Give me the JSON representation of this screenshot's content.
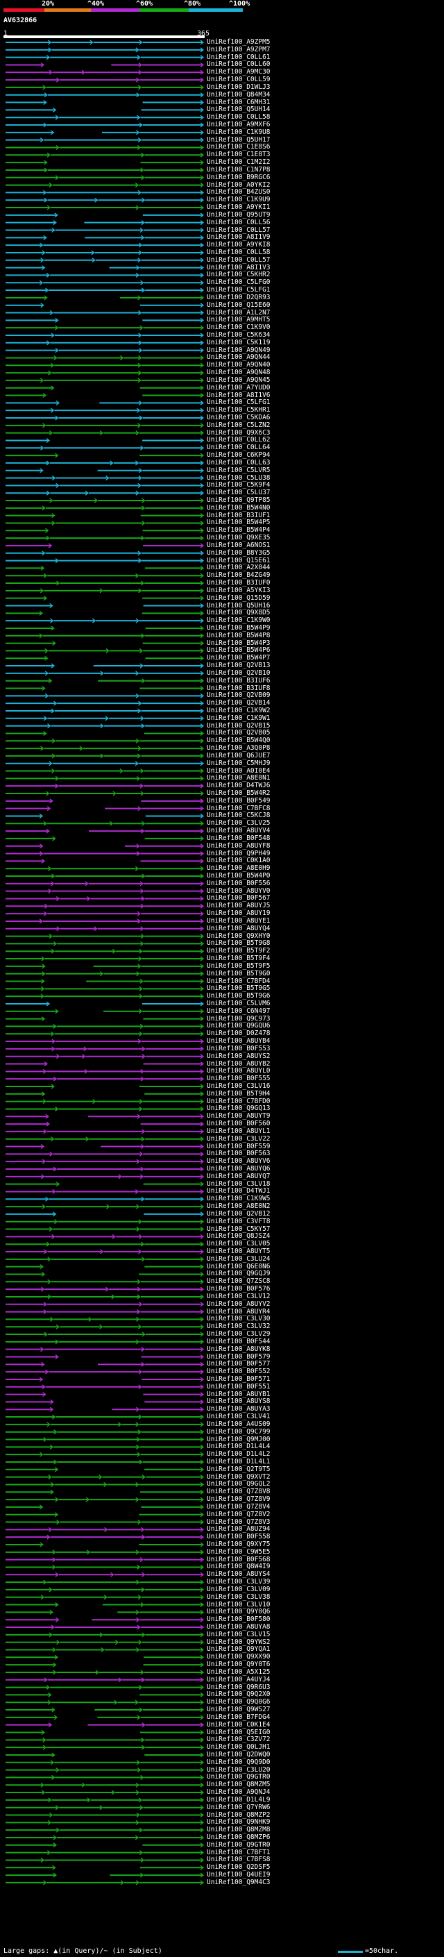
{
  "header": {
    "scale_labels": [
      "20%",
      "^40%",
      "^60%",
      "^80%",
      "^100%"
    ],
    "scale_colors": [
      "#e8102a",
      "#e07b1a",
      "#b02cd0",
      "#18a818",
      "#1cb3d8"
    ],
    "query_id": "AV632866",
    "query_start": "1",
    "query_end": "365"
  },
  "rows": [
    {
      "id": "UniRef100_A9ZPM5",
      "color": "cyan"
    },
    {
      "id": "UniRef100_A9ZPM7",
      "color": "cyan"
    },
    {
      "id": "UniRef100_C0LL61",
      "color": "cyan"
    },
    {
      "id": "UniRef100_C0LL60",
      "color": "magenta"
    },
    {
      "id": "UniRef100_A9MC30",
      "color": "magenta"
    },
    {
      "id": "UniRef100_C0LL59",
      "color": "magenta"
    },
    {
      "id": "UniRef100_D1WLJ3",
      "color": "green"
    },
    {
      "id": "UniRef100_Q84M34",
      "color": "cyan"
    },
    {
      "id": "UniRef100_C6MH31",
      "color": "cyan"
    },
    {
      "id": "UniRef100_Q5UH14",
      "color": "cyan"
    },
    {
      "id": "UniRef100_C0LL58",
      "color": "cyan"
    },
    {
      "id": "UniRef100_A9MXF6",
      "color": "cyan"
    },
    {
      "id": "UniRef100_C1K9U8",
      "color": "cyan"
    },
    {
      "id": "UniRef100_Q5UH17",
      "color": "cyan"
    },
    {
      "id": "UniRef100_C1E8S6",
      "color": "green"
    },
    {
      "id": "UniRef100_C1E8T3",
      "color": "green"
    },
    {
      "id": "UniRef100_C1M2I2",
      "color": "green"
    },
    {
      "id": "UniRef100_C1N7P8",
      "color": "green"
    },
    {
      "id": "UniRef100_B9RGC6",
      "color": "green"
    },
    {
      "id": "UniRef100_A0YKI2",
      "color": "green"
    },
    {
      "id": "UniRef100_B4ZUS0",
      "color": "cyan"
    },
    {
      "id": "UniRef100_C1K9U9",
      "color": "cyan"
    },
    {
      "id": "UniRef100_A9YKI1",
      "color": "green"
    },
    {
      "id": "UniRef100_Q95UT9",
      "color": "cyan"
    },
    {
      "id": "UniRef100_C0LL56",
      "color": "cyan"
    },
    {
      "id": "UniRef100_C0LL57",
      "color": "cyan"
    },
    {
      "id": "UniRef100_A8I1V9",
      "color": "cyan"
    },
    {
      "id": "UniRef100_A9YKI8",
      "color": "cyan"
    },
    {
      "id": "UniRef100_C0LL58",
      "color": "cyan"
    },
    {
      "id": "UniRef100_C0LL57",
      "color": "cyan"
    },
    {
      "id": "UniRef100_A8I1V3",
      "color": "cyan"
    },
    {
      "id": "UniRef100_C5KHR2",
      "color": "cyan"
    },
    {
      "id": "UniRef100_C5LFG0",
      "color": "cyan"
    },
    {
      "id": "UniRef100_C5LFG1",
      "color": "cyan"
    },
    {
      "id": "UniRef100_D2QR93",
      "color": "green"
    },
    {
      "id": "UniRef100_Q15E60",
      "color": "cyan"
    },
    {
      "id": "UniRef100_A1L2N7",
      "color": "cyan"
    },
    {
      "id": "UniRef100_A9MHT5",
      "color": "cyan"
    },
    {
      "id": "UniRef100_C1K9V0",
      "color": "green"
    },
    {
      "id": "UniRef100_C5K634",
      "color": "cyan"
    },
    {
      "id": "UniRef100_C5K119",
      "color": "cyan"
    },
    {
      "id": "UniRef100_A9QN49",
      "color": "cyan"
    },
    {
      "id": "UniRef100_A9QN44",
      "color": "green"
    },
    {
      "id": "UniRef100_A9QN40",
      "color": "green"
    },
    {
      "id": "UniRef100_A9QN48",
      "color": "green"
    },
    {
      "id": "UniRef100_A9QN45",
      "color": "green"
    },
    {
      "id": "UniRef100_A7YUD0",
      "color": "green"
    },
    {
      "id": "UniRef100_A8I1V6",
      "color": "green"
    },
    {
      "id": "UniRef100_C5LFG1",
      "color": "cyan"
    },
    {
      "id": "UniRef100_C5KHR1",
      "color": "cyan"
    },
    {
      "id": "UniRef100_C5KDA6",
      "color": "cyan"
    },
    {
      "id": "UniRef100_C5LZN2",
      "color": "green"
    },
    {
      "id": "UniRef100_Q9X6C3",
      "color": "green"
    },
    {
      "id": "UniRef100_C0LL62",
      "color": "cyan"
    },
    {
      "id": "UniRef100_C0LL64",
      "color": "cyan"
    },
    {
      "id": "UniRef100_C6KP94",
      "color": "green"
    },
    {
      "id": "UniRef100_C0LL63",
      "color": "cyan"
    },
    {
      "id": "UniRef100_C5LVR5",
      "color": "cyan"
    },
    {
      "id": "UniRef100_C5LU38",
      "color": "cyan"
    },
    {
      "id": "UniRef100_C5K9F4",
      "color": "cyan"
    },
    {
      "id": "UniRef100_C5LU37",
      "color": "cyan"
    },
    {
      "id": "UniRef100_Q9TP85",
      "color": "green"
    },
    {
      "id": "UniRef100_B5W4N0",
      "color": "green"
    },
    {
      "id": "UniRef100_B3IUF1",
      "color": "green"
    },
    {
      "id": "UniRef100_B5W4P5",
      "color": "green"
    },
    {
      "id": "UniRef100_B5W4P4",
      "color": "green"
    },
    {
      "id": "UniRef100_Q9XE35",
      "color": "green"
    },
    {
      "id": "UniRef100_A6NOS1",
      "color": "magenta"
    },
    {
      "id": "UniRef100_B8Y3G5",
      "color": "cyan"
    },
    {
      "id": "UniRef100_Q15E61",
      "color": "cyan"
    },
    {
      "id": "UniRef100_A2X044",
      "color": "green"
    },
    {
      "id": "UniRef100_B4ZG49",
      "color": "green"
    },
    {
      "id": "UniRef100_B3IUF0",
      "color": "green"
    },
    {
      "id": "UniRef100_A5YKI3",
      "color": "green"
    },
    {
      "id": "UniRef100_Q15D59",
      "color": "green"
    },
    {
      "id": "UniRef100_Q5UH16",
      "color": "cyan"
    },
    {
      "id": "UniRef100_Q9X8D5",
      "color": "green"
    },
    {
      "id": "UniRef100_C1K9W0",
      "color": "cyan"
    },
    {
      "id": "UniRef100_B5W4P9",
      "color": "green"
    },
    {
      "id": "UniRef100_B5W4P8",
      "color": "green"
    },
    {
      "id": "UniRef100_B5W4P3",
      "color": "green"
    },
    {
      "id": "UniRef100_B5W4P6",
      "color": "green"
    },
    {
      "id": "UniRef100_B5W4P7",
      "color": "green"
    },
    {
      "id": "UniRef100_Q2VB13",
      "color": "cyan"
    },
    {
      "id": "UniRef100_Q2VB10",
      "color": "cyan"
    },
    {
      "id": "UniRef100_B3IUF6",
      "color": "green"
    },
    {
      "id": "UniRef100_B3IUF8",
      "color": "green"
    },
    {
      "id": "UniRef100_Q2VB09",
      "color": "cyan"
    },
    {
      "id": "UniRef100_Q2VB14",
      "color": "cyan"
    },
    {
      "id": "UniRef100_C1K9W2",
      "color": "cyan"
    },
    {
      "id": "UniRef100_C1K9W1",
      "color": "cyan"
    },
    {
      "id": "UniRef100_Q2VB15",
      "color": "cyan"
    },
    {
      "id": "UniRef100_Q2VB05",
      "color": "green"
    },
    {
      "id": "UniRef100_B5W4Q0",
      "color": "green"
    },
    {
      "id": "UniRef100_A3Q0P8",
      "color": "green"
    },
    {
      "id": "UniRef100_Q6JUE7",
      "color": "green"
    },
    {
      "id": "UniRef100_C5MHJ9",
      "color": "cyan"
    },
    {
      "id": "UniRef100_A0I0E4",
      "color": "green"
    },
    {
      "id": "UniRef100_A8E0N1",
      "color": "green"
    },
    {
      "id": "UniRef100_D4TWJ6",
      "color": "magenta"
    },
    {
      "id": "UniRef100_B5W4R2",
      "color": "green"
    },
    {
      "id": "UniRef100_B0F549",
      "color": "magenta"
    },
    {
      "id": "UniRef100_C7BFC8",
      "color": "magenta"
    },
    {
      "id": "UniRef100_C5KCJ8",
      "color": "cyan"
    },
    {
      "id": "UniRef100_C3LV25",
      "color": "green"
    },
    {
      "id": "UniRef100_A8UYV4",
      "color": "magenta"
    },
    {
      "id": "UniRef100_B0F548",
      "color": "green"
    },
    {
      "id": "UniRef100_A8UYF8",
      "color": "magenta"
    },
    {
      "id": "UniRef100_Q9PH49",
      "color": "magenta"
    },
    {
      "id": "UniRef100_C0K1A0",
      "color": "magenta"
    },
    {
      "id": "UniRef100_A8E0H9",
      "color": "green"
    },
    {
      "id": "UniRef100_B5W4P0",
      "color": "green"
    },
    {
      "id": "UniRef100_B0F556",
      "color": "magenta"
    },
    {
      "id": "UniRef100_A8UYV0",
      "color": "magenta"
    },
    {
      "id": "UniRef100_B0F567",
      "color": "magenta"
    },
    {
      "id": "UniRef100_A8UYJ5",
      "color": "magenta"
    },
    {
      "id": "UniRef100_A8UY19",
      "color": "magenta"
    },
    {
      "id": "UniRef100_A8UYE1",
      "color": "magenta"
    },
    {
      "id": "UniRef100_A8UYQ4",
      "color": "magenta"
    },
    {
      "id": "UniRef100_Q9XHY0",
      "color": "green"
    },
    {
      "id": "UniRef100_B5T9G8",
      "color": "green"
    },
    {
      "id": "UniRef100_B5T9F2",
      "color": "green"
    },
    {
      "id": "UniRef100_B5T9F4",
      "color": "green"
    },
    {
      "id": "UniRef100_B5T9F5",
      "color": "green"
    },
    {
      "id": "UniRef100_B5T9G0",
      "color": "green"
    },
    {
      "id": "UniRef100_C7BFD4",
      "color": "green"
    },
    {
      "id": "UniRef100_B5T9G5",
      "color": "green"
    },
    {
      "id": "UniRef100_B5T9G6",
      "color": "green"
    },
    {
      "id": "UniRef100_C5LVM6",
      "color": "cyan"
    },
    {
      "id": "UniRef100_C6N497",
      "color": "green"
    },
    {
      "id": "UniRef100_Q9C973",
      "color": "green"
    },
    {
      "id": "UniRef100_Q9GQU6",
      "color": "green"
    },
    {
      "id": "UniRef100_D0Z478",
      "color": "green"
    },
    {
      "id": "UniRef100_A8UYB4",
      "color": "magenta"
    },
    {
      "id": "UniRef100_B0F553",
      "color": "magenta"
    },
    {
      "id": "UniRef100_A8UYS2",
      "color": "magenta"
    },
    {
      "id": "UniRef100_A8UYB2",
      "color": "magenta"
    },
    {
      "id": "UniRef100_A8UYL0",
      "color": "magenta"
    },
    {
      "id": "UniRef100_B0F555",
      "color": "magenta"
    },
    {
      "id": "UniRef100_C3LV16",
      "color": "green"
    },
    {
      "id": "UniRef100_B5T9H4",
      "color": "green"
    },
    {
      "id": "UniRef100_C7BFD0",
      "color": "green"
    },
    {
      "id": "UniRef100_Q9GQ13",
      "color": "green"
    },
    {
      "id": "UniRef100_A8UYT9",
      "color": "magenta"
    },
    {
      "id": "UniRef100_B0F560",
      "color": "magenta"
    },
    {
      "id": "UniRef100_A8UYL1",
      "color": "magenta"
    },
    {
      "id": "UniRef100_C3LV22",
      "color": "green"
    },
    {
      "id": "UniRef100_B0F559",
      "color": "magenta"
    },
    {
      "id": "UniRef100_B0F563",
      "color": "magenta"
    },
    {
      "id": "UniRef100_A8UYV6",
      "color": "magenta"
    },
    {
      "id": "UniRef100_A8UYQ6",
      "color": "magenta"
    },
    {
      "id": "UniRef100_A8UYQ7",
      "color": "magenta"
    },
    {
      "id": "UniRef100_C3LV18",
      "color": "green"
    },
    {
      "id": "UniRef100_D4TWJ1",
      "color": "magenta"
    },
    {
      "id": "UniRef100_C1K9W5",
      "color": "cyan"
    },
    {
      "id": "UniRef100_A8E0N2",
      "color": "green"
    },
    {
      "id": "UniRef100_Q2VB12",
      "color": "cyan"
    },
    {
      "id": "UniRef100_C3VFT8",
      "color": "green"
    },
    {
      "id": "UniRef100_C5KY57",
      "color": "green"
    },
    {
      "id": "UniRef100_Q8JSZ4",
      "color": "magenta"
    },
    {
      "id": "UniRef100_C3LV05",
      "color": "green"
    },
    {
      "id": "UniRef100_A8UYT5",
      "color": "magenta"
    },
    {
      "id": "UniRef100_C3LU24",
      "color": "green"
    },
    {
      "id": "UniRef100_Q6E0N6",
      "color": "green"
    },
    {
      "id": "UniRef100_Q9GQJ9",
      "color": "green"
    },
    {
      "id": "UniRef100_Q7ZSC8",
      "color": "green"
    },
    {
      "id": "UniRef100_B0F576",
      "color": "magenta"
    },
    {
      "id": "UniRef100_C3LV12",
      "color": "green"
    },
    {
      "id": "UniRef100_A8UYV2",
      "color": "magenta"
    },
    {
      "id": "UniRef100_A8UYR4",
      "color": "magenta"
    },
    {
      "id": "UniRef100_C3LV30",
      "color": "green"
    },
    {
      "id": "UniRef100_C3LV32",
      "color": "green"
    },
    {
      "id": "UniRef100_C3LV29",
      "color": "green"
    },
    {
      "id": "UniRef100_B0F544",
      "color": "green"
    },
    {
      "id": "UniRef100_A8UYK8",
      "color": "magenta"
    },
    {
      "id": "UniRef100_B0F579",
      "color": "magenta"
    },
    {
      "id": "UniRef100_B0F577",
      "color": "magenta"
    },
    {
      "id": "UniRef100_B0F552",
      "color": "magenta"
    },
    {
      "id": "UniRef100_B0F571",
      "color": "magenta"
    },
    {
      "id": "UniRef100_B0F551",
      "color": "magenta"
    },
    {
      "id": "UniRef100_A8UYB1",
      "color": "magenta"
    },
    {
      "id": "UniRef100_A8UYS8",
      "color": "magenta"
    },
    {
      "id": "UniRef100_A8UYA3",
      "color": "magenta"
    },
    {
      "id": "UniRef100_C3LV41",
      "color": "green"
    },
    {
      "id": "UniRef100_A4US09",
      "color": "green"
    },
    {
      "id": "UniRef100_Q9C799",
      "color": "green"
    },
    {
      "id": "UniRef100_Q9MJ00",
      "color": "green"
    },
    {
      "id": "UniRef100_D1L4L4",
      "color": "green"
    },
    {
      "id": "UniRef100_D1L4L2",
      "color": "green"
    },
    {
      "id": "UniRef100_D1L4L1",
      "color": "green"
    },
    {
      "id": "UniRef100_Q2T9T5",
      "color": "green"
    },
    {
      "id": "UniRef100_Q9XVT2",
      "color": "green"
    },
    {
      "id": "UniRef100_Q9GQL2",
      "color": "green"
    },
    {
      "id": "UniRef100_Q7Z8V8",
      "color": "green"
    },
    {
      "id": "UniRef100_Q7Z8V9",
      "color": "green"
    },
    {
      "id": "UniRef100_Q7Z8V4",
      "color": "green"
    },
    {
      "id": "UniRef100_Q7Z8V2",
      "color": "green"
    },
    {
      "id": "UniRef100_Q7Z8V3",
      "color": "green"
    },
    {
      "id": "UniRef100_A8UZ94",
      "color": "magenta"
    },
    {
      "id": "UniRef100_B0F558",
      "color": "magenta"
    },
    {
      "id": "UniRef100_Q9XY75",
      "color": "green"
    },
    {
      "id": "UniRef100_C9W5E5",
      "color": "green"
    },
    {
      "id": "UniRef100_B0F568",
      "color": "magenta"
    },
    {
      "id": "UniRef100_Q8W4I9",
      "color": "green"
    },
    {
      "id": "UniRef100_A8UYS4",
      "color": "magenta"
    },
    {
      "id": "UniRef100_C3LV39",
      "color": "green"
    },
    {
      "id": "UniRef100_C3LV09",
      "color": "green"
    },
    {
      "id": "UniRef100_C3LV38",
      "color": "green"
    },
    {
      "id": "UniRef100_C3LV10",
      "color": "green"
    },
    {
      "id": "UniRef100_Q9Y0Q6",
      "color": "green"
    },
    {
      "id": "UniRef100_B0F580",
      "color": "magenta"
    },
    {
      "id": "UniRef100_A8UYA8",
      "color": "magenta"
    },
    {
      "id": "UniRef100_C3LV15",
      "color": "green"
    },
    {
      "id": "UniRef100_Q9YWS2",
      "color": "green"
    },
    {
      "id": "UniRef100_Q9YQA1",
      "color": "green"
    },
    {
      "id": "UniRef100_Q9XX90",
      "color": "green"
    },
    {
      "id": "UniRef100_Q9Y0T6",
      "color": "green"
    },
    {
      "id": "UniRef100_A5X125",
      "color": "green"
    },
    {
      "id": "UniRef100_A4UYJ4",
      "color": "magenta"
    },
    {
      "id": "UniRef100_Q9R6U3",
      "color": "green"
    },
    {
      "id": "UniRef100_Q9Q2X0",
      "color": "green"
    },
    {
      "id": "UniRef100_Q9Q0G6",
      "color": "green"
    },
    {
      "id": "UniRef100_Q9WS27",
      "color": "green"
    },
    {
      "id": "UniRef100_B7FDG4",
      "color": "green"
    },
    {
      "id": "UniRef100_C0K1E4",
      "color": "magenta"
    },
    {
      "id": "UniRef100_Q5EIG0",
      "color": "green"
    },
    {
      "id": "UniRef100_C3ZV72",
      "color": "green"
    },
    {
      "id": "UniRef100_Q0LJH1",
      "color": "green"
    },
    {
      "id": "UniRef100_Q2DWQ0",
      "color": "green"
    },
    {
      "id": "UniRef100_Q9Q9D0",
      "color": "green"
    },
    {
      "id": "UniRef100_C3LU20",
      "color": "green"
    },
    {
      "id": "UniRef100_Q9GTR0",
      "color": "green"
    },
    {
      "id": "UniRef100_Q8MZM5",
      "color": "green"
    },
    {
      "id": "UniRef100_A9QNJ4",
      "color": "green"
    },
    {
      "id": "UniRef100_D1L4L9",
      "color": "green"
    },
    {
      "id": "UniRef100_Q7YRW6",
      "color": "green"
    },
    {
      "id": "UniRef100_Q8MZP2",
      "color": "green"
    },
    {
      "id": "UniRef100_Q9NHK9",
      "color": "green"
    },
    {
      "id": "UniRef100_Q8MZM8",
      "color": "green"
    },
    {
      "id": "UniRef100_Q8MZP6",
      "color": "green"
    },
    {
      "id": "UniRef100_Q9GTR0",
      "color": "green"
    },
    {
      "id": "UniRef100_C7BFT1",
      "color": "green"
    },
    {
      "id": "UniRef100_C7BFS8",
      "color": "green"
    },
    {
      "id": "UniRef100_Q2DSF5",
      "color": "green"
    },
    {
      "id": "UniRef100_Q4UEI9",
      "color": "green"
    },
    {
      "id": "UniRef100_Q9M4C3",
      "color": "green"
    }
  ],
  "footer": {
    "legend": "Large gaps: ▲(in Query)/~ (in Subject)",
    "scale_note": "=50char."
  },
  "palette": {
    "cyan": "#1cb3d8",
    "magenta": "#b02cd0",
    "green": "#18a818",
    "white": "#ffffff",
    "background": "#000000"
  }
}
